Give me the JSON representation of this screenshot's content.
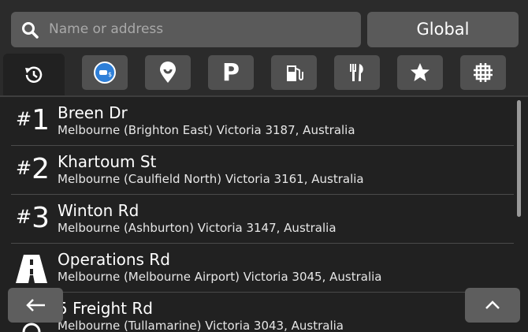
{
  "search": {
    "placeholder": "Name or address",
    "icon": "search-icon"
  },
  "scope_button": {
    "label": "Global"
  },
  "category_tabs": [
    {
      "name": "recent",
      "icon": "history-icon",
      "active": true
    },
    {
      "name": "traffic",
      "icon": "speed-camera-icon",
      "active": false
    },
    {
      "name": "places",
      "icon": "map-pin-icon",
      "active": false
    },
    {
      "name": "parking",
      "icon": "parking-icon",
      "label": "P",
      "active": false
    },
    {
      "name": "fuel",
      "icon": "fuel-pump-icon",
      "active": false
    },
    {
      "name": "restaurants",
      "icon": "fork-knife-icon",
      "active": false
    },
    {
      "name": "favorites",
      "icon": "star-icon",
      "active": false
    },
    {
      "name": "map",
      "icon": "grid-map-icon",
      "active": false
    }
  ],
  "results": [
    {
      "rank": "1",
      "name": "Breen Dr",
      "address": "Melbourne (Brighton East) Victoria 3187, Australia"
    },
    {
      "rank": "2",
      "name": "Khartoum St",
      "address": "Melbourne (Caulfield North) Victoria 3161, Australia"
    },
    {
      "rank": "3",
      "name": "Winton Rd",
      "address": "Melbourne (Ashburton) Victoria 3147, Australia"
    },
    {
      "rank": "",
      "icon": "road-icon",
      "name": "Operations Rd",
      "address": "Melbourne (Melbourne Airport) Victoria 3045, Australia"
    },
    {
      "rank": "",
      "icon": "road-icon",
      "name": "5 Freight Rd",
      "address": "Melbourne (Tullamarine) Victoria 3043, Australia"
    }
  ],
  "buttons": {
    "back": "back-arrow-icon",
    "up": "chevron-up-icon"
  },
  "colors": {
    "background": "#212121",
    "header": "#2b2b2b",
    "control": "#5a5a5a",
    "traffic_icon": "#2e7fd8"
  }
}
